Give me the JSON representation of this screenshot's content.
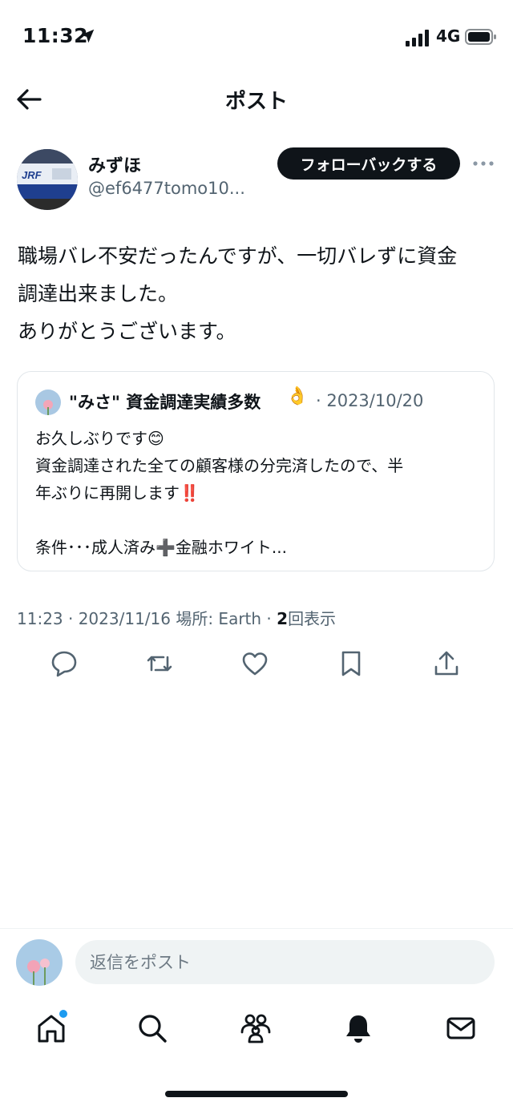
{
  "status_bar": {
    "time": "11:32",
    "network": "4G"
  },
  "nav": {
    "title": "ポスト"
  },
  "author": {
    "name": "みずほ",
    "handle": "@ef6477tomo10...",
    "follow_label": "フォローバックする",
    "avatar_caption": "JRF"
  },
  "post": {
    "lines": [
      "職場バレ不安だったんですが、一切バレずに資金",
      "調達出来ました。",
      "ありがとうございます。"
    ]
  },
  "quote": {
    "name": "\"みさ\" 資金調達実績多数",
    "name_emoji": "👌",
    "date": "· 2023/10/20",
    "lines": [
      "お久しぶりです😊",
      "資金調達された全ての顧客様の分完済したので、半",
      "年ぶりに再開します‼️",
      "",
      "条件･･･成人済み➕金融ホワイト..."
    ]
  },
  "meta": {
    "prefix": "11:23 · 2023/11/16 場所: Earth · ",
    "views_count": "2",
    "views_label": "回表示"
  },
  "reply": {
    "placeholder": "返信をポスト"
  },
  "colors": {
    "text": "#0f1419",
    "secondary": "#536471",
    "accent": "#1d9bf0",
    "border": "#e1e6ea"
  },
  "icons": {
    "actions": [
      "reply-icon",
      "repost-icon",
      "like-icon",
      "bookmark-icon",
      "share-icon"
    ],
    "tabs": [
      "home-icon",
      "search-icon",
      "communities-icon",
      "notifications-icon",
      "messages-icon"
    ]
  }
}
